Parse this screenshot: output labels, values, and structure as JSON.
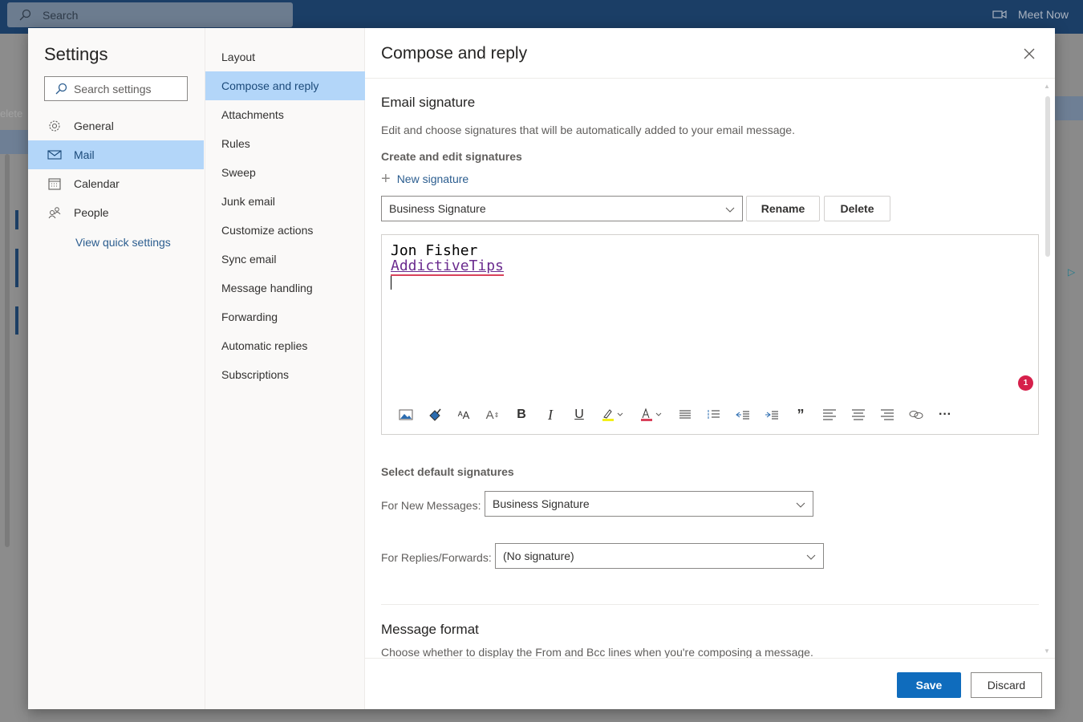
{
  "topbar": {
    "search_placeholder": "Search",
    "meet_now_label": "Meet Now"
  },
  "background": {
    "delete_label": "elete"
  },
  "settings_nav": {
    "title": "Settings",
    "search_placeholder": "Search settings",
    "items": [
      {
        "label": "General",
        "icon": "gear-icon",
        "selected": false
      },
      {
        "label": "Mail",
        "icon": "mail-icon",
        "selected": true
      },
      {
        "label": "Calendar",
        "icon": "calendar-icon",
        "selected": false
      },
      {
        "label": "People",
        "icon": "people-icon",
        "selected": false
      }
    ],
    "quick_settings_link": "View quick settings"
  },
  "mail_nav": {
    "items": [
      {
        "label": "Layout",
        "selected": false
      },
      {
        "label": "Compose and reply",
        "selected": true
      },
      {
        "label": "Attachments",
        "selected": false
      },
      {
        "label": "Rules",
        "selected": false
      },
      {
        "label": "Sweep",
        "selected": false
      },
      {
        "label": "Junk email",
        "selected": false
      },
      {
        "label": "Customize actions",
        "selected": false
      },
      {
        "label": "Sync email",
        "selected": false
      },
      {
        "label": "Message handling",
        "selected": false
      },
      {
        "label": "Forwarding",
        "selected": false
      },
      {
        "label": "Automatic replies",
        "selected": false
      },
      {
        "label": "Subscriptions",
        "selected": false
      }
    ]
  },
  "main": {
    "title": "Compose and reply",
    "email_signature": {
      "title": "Email signature",
      "description": "Edit and choose signatures that will be automatically added to your email message.",
      "create_edit_label": "Create and edit signatures",
      "new_signature_label": "New signature",
      "selected_signature": "Business Signature",
      "rename_label": "Rename",
      "delete_label": "Delete",
      "editor": {
        "line1": "Jon Fisher",
        "line2": "AddictiveTips",
        "badge_count": "1"
      },
      "toolbar": [
        "insert-picture",
        "format-painter",
        "font-size",
        "grow-font",
        "bold",
        "italic",
        "underline",
        "highlight",
        "font-color",
        "bullets",
        "numbering",
        "decrease-indent",
        "increase-indent",
        "quote",
        "align-left",
        "align-center",
        "align-right",
        "link",
        "more-options"
      ]
    },
    "default_signatures": {
      "title": "Select default signatures",
      "new_messages_label": "For New Messages:",
      "new_messages_value": "Business Signature",
      "replies_label": "For Replies/Forwards:",
      "replies_value": "(No signature)"
    },
    "message_format": {
      "title": "Message format",
      "description": "Choose whether to display the From and Bcc lines when you're composing a message."
    }
  },
  "footer": {
    "save_label": "Save",
    "discard_label": "Discard"
  },
  "colors": {
    "accent": "#0f6cbd",
    "selected_bg": "#b3d6f9",
    "topbar": "#1b3e66",
    "badge": "#d6204b"
  }
}
